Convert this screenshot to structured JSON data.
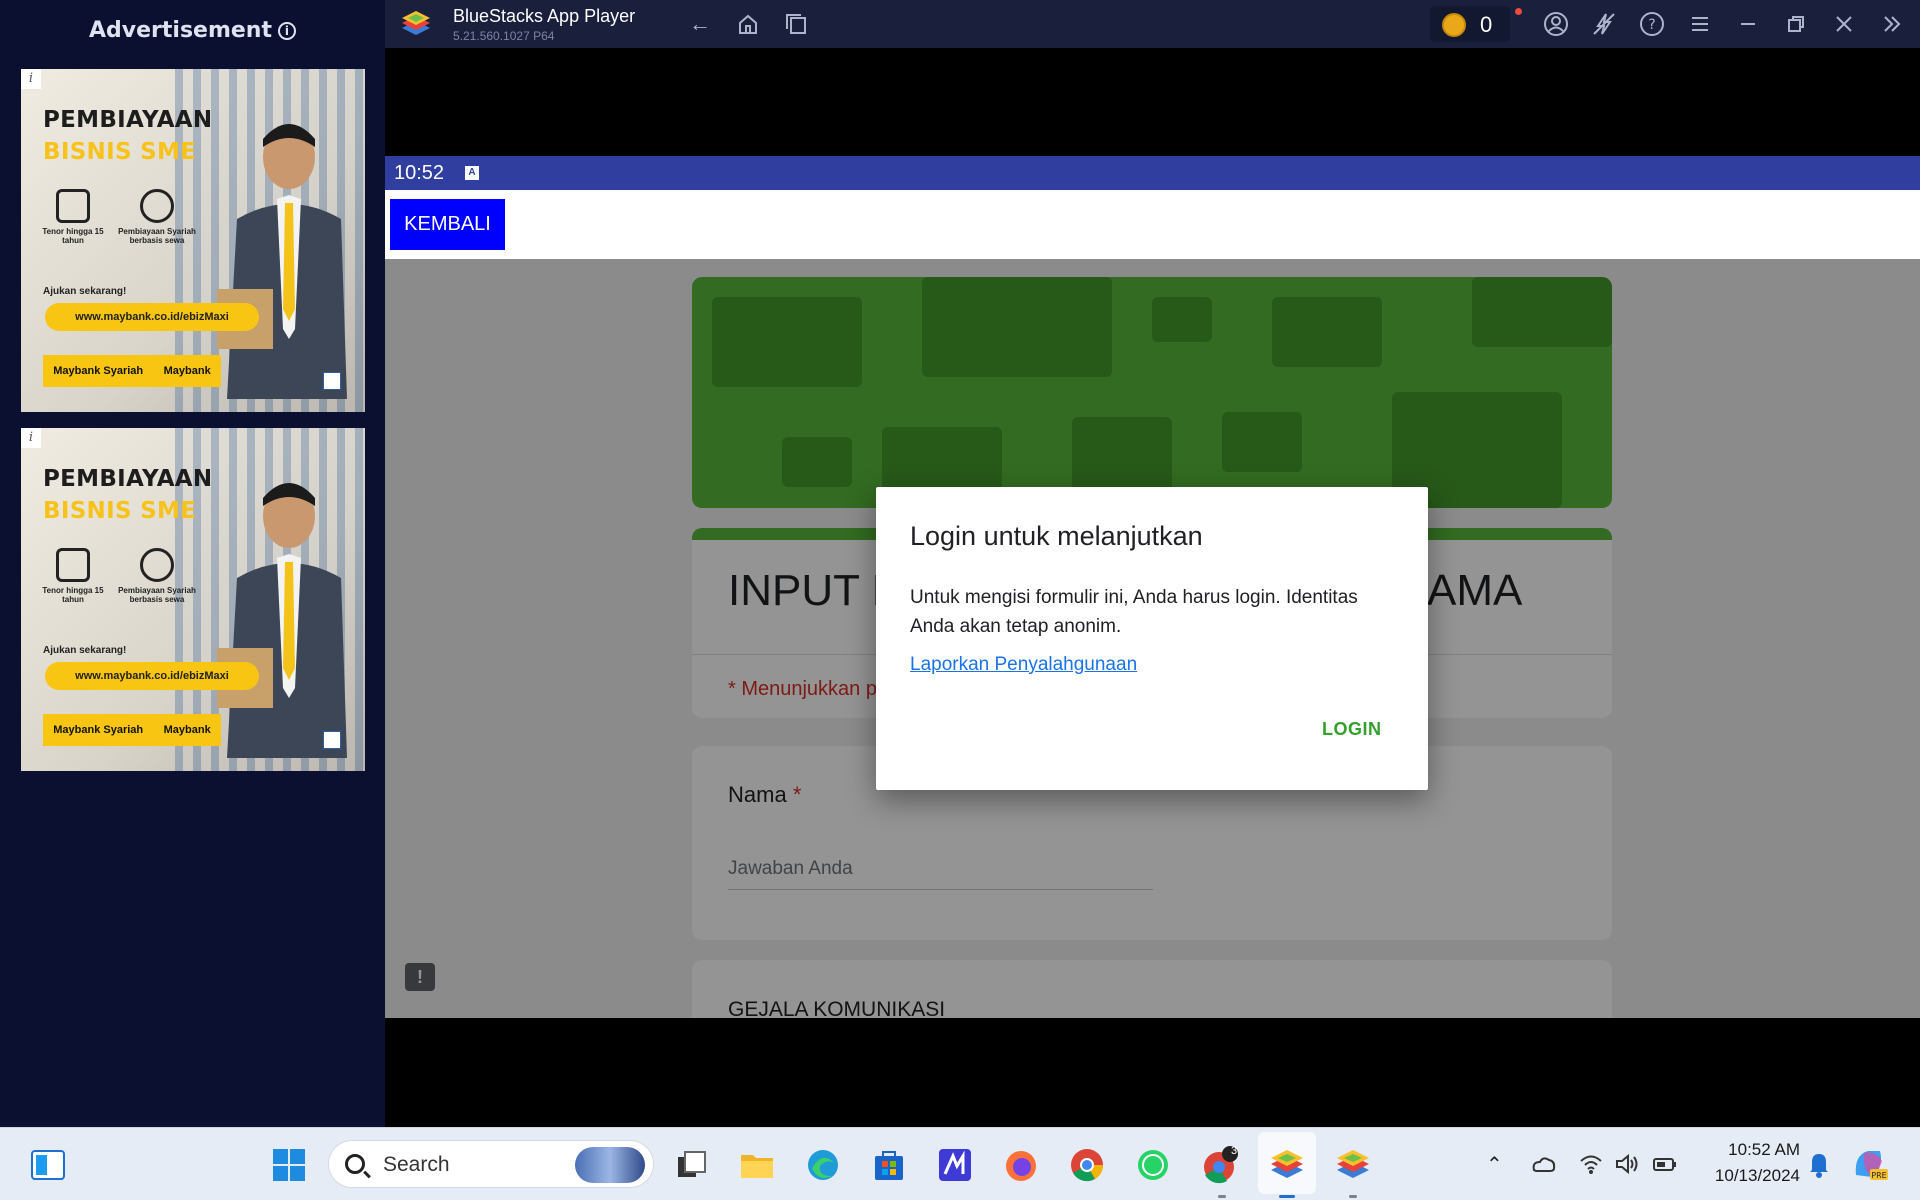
{
  "sidebar": {
    "ad_title": "Advertisement",
    "ad_info_glyph": "i",
    "ads": [
      {
        "line1": "PEMBIAYAAN",
        "line2": "BISNIS SME",
        "feature1": "Tenor hingga 15 tahun",
        "feature2": "Pembiayaan Syariah berbasis sewa",
        "cta": "Ajukan sekarang!",
        "url": "www.maybank.co.id/ebizMaxi",
        "logo1": "Maybank Syariah",
        "logo2": "Maybank"
      },
      {
        "line1": "PEMBIAYAAN",
        "line2": "BISNIS SME",
        "feature1": "Tenor hingga 15 tahun",
        "feature2": "Pembiayaan Syariah berbasis sewa",
        "cta": "Ajukan sekarang!",
        "url": "www.maybank.co.id/ebizMaxi",
        "logo1": "Maybank Syariah",
        "logo2": "Maybank"
      }
    ]
  },
  "titlebar": {
    "app_name": "BlueStacks App Player",
    "version": "5.21.560.1027  P64",
    "coins": "0",
    "icons": [
      "back-icon",
      "home-icon",
      "multitask-icon",
      "account-icon",
      "eco-mode-icon",
      "help-icon",
      "menu-icon",
      "minimize-icon",
      "restore-icon",
      "close-icon",
      "collapse-sidebar-icon"
    ]
  },
  "android": {
    "status_time": "10:52",
    "status_badge": "A",
    "back_button": "KEMBALI"
  },
  "form": {
    "title_start": "INPUT I",
    "title_end": "AMA",
    "required_note": "* Menunjukkan p",
    "q1_label": "Nama",
    "q1_required": "*",
    "q1_placeholder": "Jawaban Anda",
    "q2_label": "GEJALA KOMUNIKASI"
  },
  "dialog": {
    "title": "Login untuk melanjutkan",
    "body": "Untuk mengisi formulir ini, Anda harus login. Identitas Anda akan tetap anonim.",
    "link": "Laporkan Penyalahgunaan",
    "login_button": "LOGIN"
  },
  "taskbar": {
    "search_placeholder": "Search",
    "clock_time": "10:52 AM",
    "clock_date": "10/13/2024",
    "chrome_badge": "3"
  },
  "colors": {
    "sidebar_bg": "#0b1031",
    "titlebar_bg": "#1a1f3c",
    "statusbar": "#303f9f",
    "kembali_bg": "#0000ff",
    "form_accent": "#56b83a",
    "login_color": "#33a02c",
    "link_color": "#1a73e8"
  }
}
